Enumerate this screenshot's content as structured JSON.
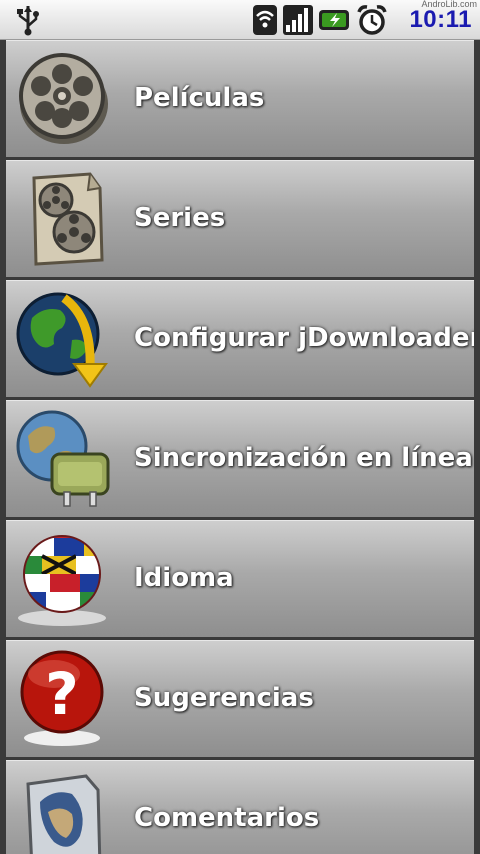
{
  "status_bar": {
    "time": "10:11",
    "watermark": "AndroLib.com",
    "icons": [
      "usb-icon",
      "wifi-icon",
      "signal-icon",
      "battery-charging-icon",
      "alarm-clock-icon"
    ]
  },
  "menu": {
    "items": [
      {
        "label": "Películas",
        "icon": "film-reel-icon"
      },
      {
        "label": "Series",
        "icon": "film-reels-paper-icon"
      },
      {
        "label": "Configurar jDownloader",
        "icon": "globe-download-arrow-icon"
      },
      {
        "label": "Sincronización en línea",
        "icon": "globe-plug-icon"
      },
      {
        "label": "Idioma",
        "icon": "flags-globe-icon"
      },
      {
        "label": "Sugerencias",
        "icon": "question-mark-icon"
      },
      {
        "label": "Comentarios",
        "icon": "quill-paper-icon"
      }
    ]
  },
  "colors": {
    "clock": "#1a1ab0",
    "item_gradient_top": "#cfcfcf",
    "item_gradient_bottom": "#8e8e8e",
    "label": "#ffffff"
  }
}
